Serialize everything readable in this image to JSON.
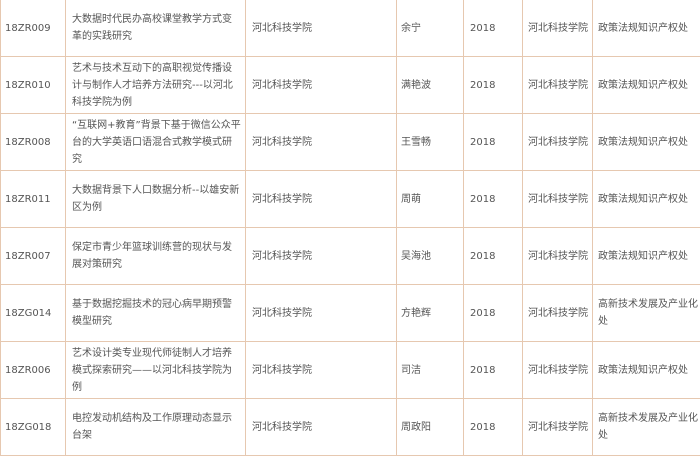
{
  "table": {
    "rows": [
      {
        "code": "18ZR009",
        "title": "大数据时代民办高校课堂教学方式变革的实践研究",
        "unit": "河北科技学院",
        "person": "余宁",
        "year": "2018",
        "org": "河北科技学院",
        "category": "政策法规知识产权处"
      },
      {
        "code": "18ZR010",
        "title": "艺术与技术互动下的高职视觉传播设计与制作人才培养方法研究---以河北科技学院为例",
        "unit": "河北科技学院",
        "person": "满艳波",
        "year": "2018",
        "org": "河北科技学院",
        "category": "政策法规知识产权处"
      },
      {
        "code": "18ZR008",
        "title": "“互联网+教育”背景下基于微信公众平台的大学英语口语混合式教学模式研究",
        "unit": "河北科技学院",
        "person": "王雪畅",
        "year": "2018",
        "org": "河北科技学院",
        "category": "政策法规知识产权处"
      },
      {
        "code": "18ZR011",
        "title": "大数据背景下人口数据分析--以雄安新区为例",
        "unit": "河北科技学院",
        "person": "周萌",
        "year": "2018",
        "org": "河北科技学院",
        "category": "政策法规知识产权处"
      },
      {
        "code": "18ZR007",
        "title": "保定市青少年篮球训练营的现状与发展对策研究",
        "unit": "河北科技学院",
        "person": "吴海池",
        "year": "2018",
        "org": "河北科技学院",
        "category": "政策法规知识产权处"
      },
      {
        "code": "18ZG014",
        "title": "基于数据挖掘技术的冠心病早期预警模型研究",
        "unit": "河北科技学院",
        "person": "方艳辉",
        "year": "2018",
        "org": "河北科技学院",
        "category": "高新技术发展及产业化处"
      },
      {
        "code": "18ZR006",
        "title": "艺术设计类专业现代师徒制人才培养模式探索研究——以河北科技学院为例",
        "unit": "河北科技学院",
        "person": "司洁",
        "year": "2018",
        "org": "河北科技学院",
        "category": "政策法规知识产权处"
      },
      {
        "code": "18ZG018",
        "title": "电控发动机结构及工作原理动态显示台架",
        "unit": "河北科技学院",
        "person": "周政阳",
        "year": "2018",
        "org": "河北科技学院",
        "category": "高新技术发展及产业化处"
      }
    ]
  }
}
